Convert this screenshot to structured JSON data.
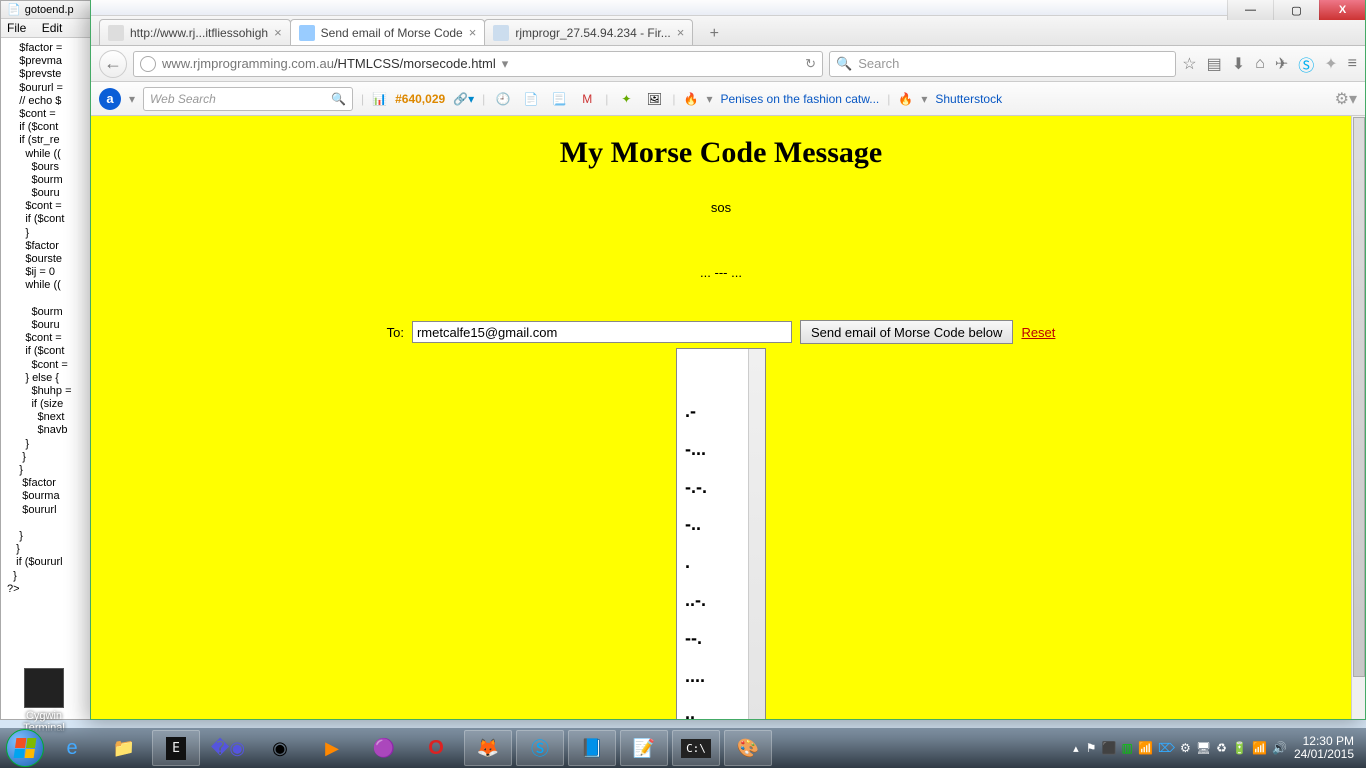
{
  "notepad": {
    "title": "gotoend.p",
    "menu": {
      "file": "File",
      "edit": "Edit"
    },
    "code": "    $factor =\n    $prevma\n    $prevste\n    $oururl =\n    // echo $\n    $cont = \n    if ($cont\n    if (str_re\n      while ((\n        $ours\n        $ourm\n        $ouru\n      $cont = \n      if ($cont\n      }\n      $factor\n      $ourste\n      $ij = 0\n      while ((\n\n        $ourm\n        $ouru\n      $cont = \n      if ($cont\n        $cont =\n      } else {\n        $huhp =\n        if (size\n          $next\n          $navb\n      }\n     }\n    }\n     $factor\n     $ourma\n     $oururl\n\n    }\n   }\n   if ($oururl\n  }\n?>"
  },
  "desktop_icon": {
    "label": "Cygwin\nTerminal"
  },
  "window_controls": {
    "min": "—",
    "max": "▢",
    "close": "X"
  },
  "tabs": [
    {
      "label": "http://www.rj...itfliessohigh",
      "active": false
    },
    {
      "label": "Send email of Morse Code",
      "active": true
    },
    {
      "label": "rjmprogr_27.54.94.234 - Fir...",
      "active": false
    }
  ],
  "url": {
    "host": "www.rjmprogramming.com.au",
    "path": "/HTMLCSS/morsecode.html"
  },
  "search_placeholder": "Search",
  "toolbar2": {
    "web_search": "Web Search",
    "rank": "#640,029",
    "link1": "Penises on the fashion catw...",
    "link2": "Shutterstock"
  },
  "page": {
    "heading": "My Morse Code Message",
    "message": "sos",
    "morse_inline": "... --- ...",
    "to_label": "To:",
    "email": "rmetcalfe15@gmail.com",
    "send_button": "Send email of Morse Code below",
    "reset": "Reset",
    "morse_lines": [
      ".-",
      "-...",
      "-.-.",
      "-..",
      ".",
      "..-.",
      "--.",
      "....",
      ".."
    ]
  },
  "taskbar": {
    "time": "12:30 PM",
    "date": "24/01/2015"
  }
}
